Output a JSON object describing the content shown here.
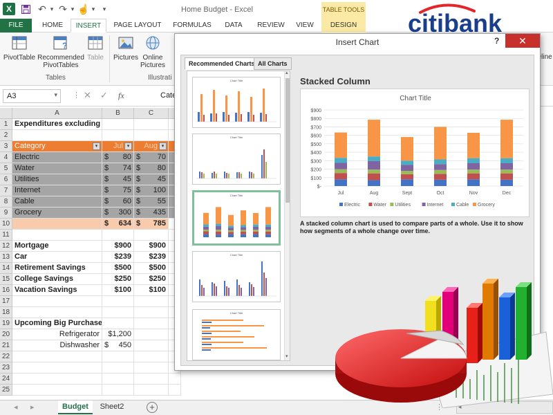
{
  "app": {
    "title": "Home Budget - Excel",
    "table_tools": "TABLE TOOLS",
    "logo_letter": "X"
  },
  "tabs": [
    "FILE",
    "HOME",
    "INSERT",
    "PAGE LAYOUT",
    "FORMULAS",
    "DATA",
    "REVIEW",
    "VIEW",
    "DESIGN"
  ],
  "ribbon": {
    "pivottable": "PivotTable",
    "recommended_pivot": "Recommended PivotTables",
    "table": "Table",
    "tables_group": "Tables",
    "pictures": "Pictures",
    "online_pictures": "Online Pictures",
    "illustrations_group": "Illustrati",
    "timeline": "meline"
  },
  "formula_bar": {
    "namebox": "A3",
    "formula": "Category"
  },
  "grid": {
    "columns": [
      "A",
      "B",
      "C"
    ],
    "rows": [
      {
        "n": "1",
        "a": "Expenditures excluding mortgage",
        "b": "",
        "c": "",
        "style": "bold"
      },
      {
        "n": "2",
        "a": "",
        "b": "",
        "c": "",
        "style": ""
      },
      {
        "n": "3",
        "a": "Category",
        "b": "Jul",
        "c": "Aug",
        "style": "hdr"
      },
      {
        "n": "4",
        "a": "Electric",
        "b": "80",
        "c": "70",
        "style": "data"
      },
      {
        "n": "5",
        "a": "Water",
        "b": "74",
        "c": "80",
        "style": "data"
      },
      {
        "n": "6",
        "a": "Utilities",
        "b": "45",
        "c": "45",
        "style": "data"
      },
      {
        "n": "7",
        "a": "Internet",
        "b": "75",
        "c": "100",
        "style": "data"
      },
      {
        "n": "8",
        "a": "Cable",
        "b": "60",
        "c": "55",
        "style": "data"
      },
      {
        "n": "9",
        "a": "Grocery",
        "b": "300",
        "c": "435",
        "style": "data"
      },
      {
        "n": "10",
        "a": "",
        "b": "634",
        "c": "785",
        "style": "total"
      },
      {
        "n": "11",
        "a": "",
        "b": "",
        "c": "",
        "style": ""
      },
      {
        "n": "12",
        "a": "Mortgage",
        "b": "$900",
        "c": "$900",
        "style": "boldrow"
      },
      {
        "n": "13",
        "a": "Car",
        "b": "$239",
        "c": "$239",
        "style": "boldrow"
      },
      {
        "n": "14",
        "a": "Retirement Savings",
        "b": "$500",
        "c": "$500",
        "style": "boldrow"
      },
      {
        "n": "15",
        "a": "College Savings",
        "b": "$250",
        "c": "$250",
        "style": "boldrow"
      },
      {
        "n": "16",
        "a": "Vacation Savings",
        "b": "$100",
        "c": "$100",
        "style": "boldrow"
      },
      {
        "n": "17",
        "a": "",
        "b": "",
        "c": "",
        "style": ""
      },
      {
        "n": "18",
        "a": "",
        "b": "",
        "c": "",
        "style": ""
      },
      {
        "n": "19",
        "a": "Upcoming Big Purchases",
        "b": "",
        "c": "",
        "style": "bold"
      },
      {
        "n": "20",
        "a": "Refrigerator",
        "b": "$1,200",
        "c": "",
        "style": "right"
      },
      {
        "n": "21",
        "a": "Dishwasher",
        "b": "450",
        "c": "",
        "style": "right"
      },
      {
        "n": "22",
        "a": "",
        "b": "",
        "c": "",
        "style": ""
      },
      {
        "n": "23",
        "a": "",
        "b": "",
        "c": "",
        "style": ""
      },
      {
        "n": "24",
        "a": "",
        "b": "",
        "c": "",
        "style": ""
      },
      {
        "n": "25",
        "a": "",
        "b": "",
        "c": "",
        "style": ""
      }
    ],
    "currency_symbol": "$"
  },
  "sheets": [
    "Budget",
    "Sheet2"
  ],
  "dialog": {
    "title": "Insert Chart",
    "help": "?",
    "close": "✕",
    "tab_recommended": "Recommended Charts",
    "tab_all": "All Charts",
    "thumb_title": "Chart Title",
    "preview_heading": "Stacked Column",
    "description": "A stacked column chart is used to compare parts of a whole. Use it to show how segments of a whole change over time."
  },
  "brand": {
    "name": "citibank"
  },
  "colors": {
    "excel_green": "#217346",
    "orange": "#ed7d31",
    "gray": "#a5a5a5",
    "citi_blue": "#1a3e8c",
    "citi_red": "#e3242b"
  },
  "chart_data": {
    "type": "bar",
    "title": "Chart Title",
    "categories": [
      "Jul",
      "Aug",
      "Sept",
      "Oct",
      "Nov",
      "Dec"
    ],
    "ylim": [
      0,
      900
    ],
    "yticks": [
      "$-",
      "$100",
      "$200",
      "$300",
      "$400",
      "$500",
      "$600",
      "$700",
      "$800",
      "$900"
    ],
    "legend_position": "bottom",
    "stacked": true,
    "series": [
      {
        "name": "Electric",
        "color": "#4472c4",
        "values": [
          80,
          70,
          80,
          75,
          80,
          75
        ]
      },
      {
        "name": "Water",
        "color": "#c0504d",
        "values": [
          74,
          80,
          60,
          70,
          70,
          75
        ]
      },
      {
        "name": "Utilities",
        "color": "#9bbb59",
        "values": [
          45,
          45,
          40,
          45,
          45,
          45
        ]
      },
      {
        "name": "Internet",
        "color": "#8064a2",
        "values": [
          75,
          100,
          70,
          70,
          75,
          75
        ]
      },
      {
        "name": "Cable",
        "color": "#4bacc6",
        "values": [
          60,
          55,
          50,
          55,
          60,
          60
        ]
      },
      {
        "name": "Grocery",
        "color": "#f79646",
        "values": [
          300,
          435,
          280,
          385,
          300,
          455
        ]
      }
    ]
  }
}
